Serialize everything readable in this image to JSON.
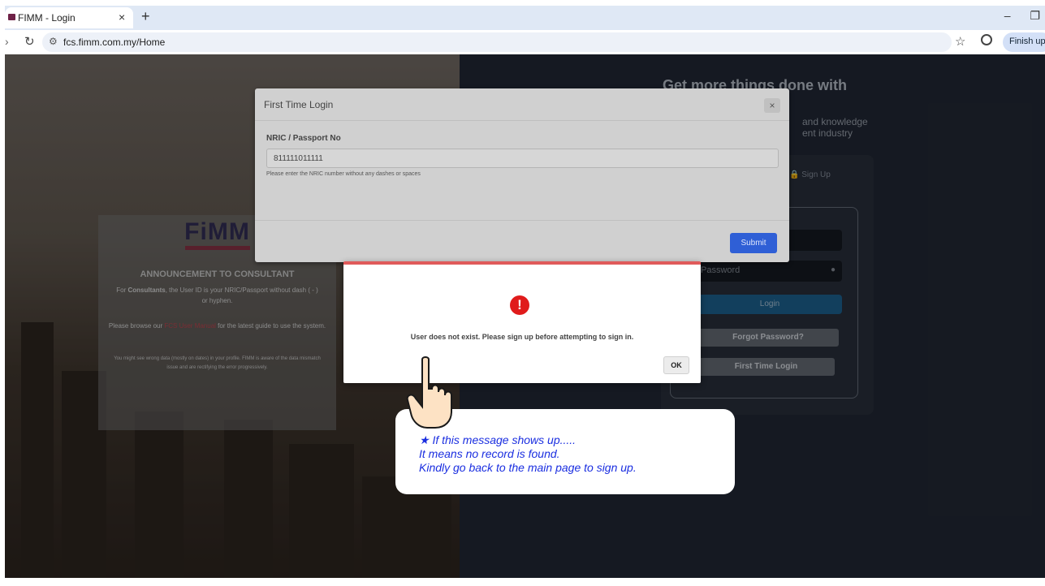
{
  "browser": {
    "tab_title": "FIMM - Login",
    "tab_close": "×",
    "new_tab": "+",
    "url": "fcs.fimm.com.my/Home",
    "update_button": "Finish update",
    "icons": [
      "favicon-icon",
      "back-icon",
      "reload-icon",
      "site-settings-icon",
      "star-icon",
      "profile-icon",
      "minimize-icon",
      "restore-icon"
    ]
  },
  "background_page": {
    "hero_title": "Get more things done with",
    "hero_subtitle_1": "and knowledge",
    "hero_subtitle_2": "ent industry",
    "signup_tab": "Sign Up",
    "password_placeholder": "Password",
    "login_button": "Login",
    "forgot_button": "Forgot Password?",
    "first_time_button": "First Time Login",
    "announcement": {
      "logo": "FiMM",
      "title": "ANNOUNCEMENT TO CONSULTANT",
      "p1_prefix": "For ",
      "p1_bold": "Consultants",
      "p1_rest": ", the User ID is your NRIC/Passport without dash ( - ) or hyphen.",
      "p2_prefix": "Please browse our ",
      "p2_link": "FCS User Manual",
      "p2_rest": " for the latest guide to use the system.",
      "p3": "You might see wrong data (mostly on dates) in your profile. FIMM is aware of the data mismatch issue and are rectifying the error progressively."
    }
  },
  "modal": {
    "title": "First Time Login",
    "close": "×",
    "field_label": "NRIC / Passport No",
    "field_value": "811111011111",
    "field_help": "Please enter the NRIC number without any dashes or spaces",
    "submit": "Submit"
  },
  "alert": {
    "icon": "!",
    "message": "User does not exist. Please sign up before attempting to sign in.",
    "ok": "OK",
    "accent_color": "#e05a5a"
  },
  "callout": {
    "line1": "★ If this message shows up.....",
    "line2": "It means no record is found.",
    "line3": "Kindly go back to the main page to sign up.",
    "color": "#1a2ee0"
  }
}
